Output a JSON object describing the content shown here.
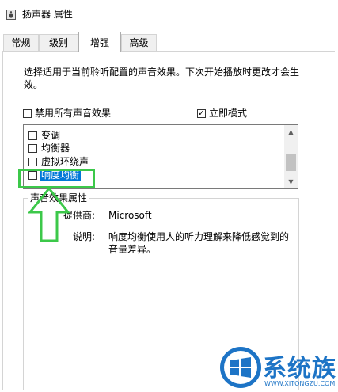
{
  "window": {
    "title": "扬声器 属性"
  },
  "tabs": [
    {
      "label": "常规"
    },
    {
      "label": "级别"
    },
    {
      "label": "增强"
    },
    {
      "label": "高级"
    }
  ],
  "enhancements": {
    "description": "选择适用于当前聆听配置的声音效果。下次开始播放时更改才会生效。",
    "disable_all": {
      "label": "禁用所有声音效果",
      "checked": false
    },
    "immediate_mode": {
      "label": "立即模式",
      "checked": true
    },
    "items": [
      {
        "label": "变调",
        "checked": false
      },
      {
        "label": "均衡器",
        "checked": false
      },
      {
        "label": "虚拟环绕声",
        "checked": false
      },
      {
        "label": "响度均衡",
        "checked": false,
        "selected": true
      }
    ]
  },
  "properties": {
    "group_label": "声音效果属性",
    "provider_label": "提供商:",
    "provider_value": "Microsoft",
    "description_label": "说明:",
    "description_value": "响度均衡使用人的听力理解来降低感觉到的音量差异。"
  },
  "watermark": {
    "brand": "系统族",
    "url": "WWW.XITONGZU.COM"
  },
  "colors": {
    "selection": "#0078d7",
    "callout": "#3cc84a",
    "brand": "#1d74c6"
  }
}
